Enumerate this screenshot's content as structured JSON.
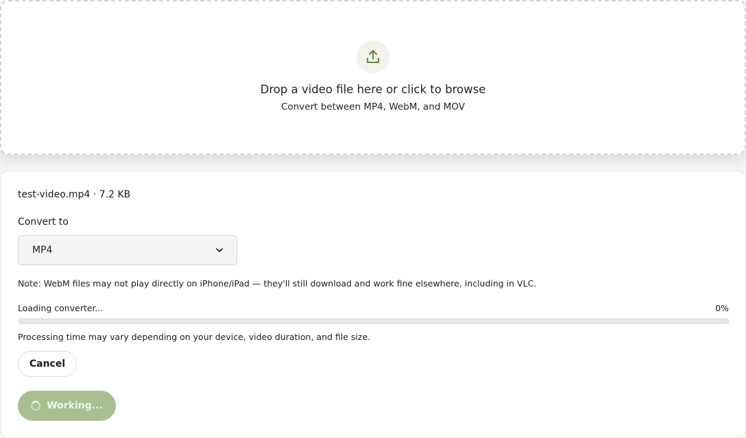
{
  "dropzone": {
    "icon": "upload-icon",
    "title": "Drop a video file here or click to browse",
    "subtitle": "Convert between MP4, WebM, and MOV"
  },
  "file": {
    "info": "test-video.mp4 · 7.2 KB"
  },
  "convert": {
    "label": "Convert to",
    "selected": "MP4"
  },
  "note": "Note: WebM files may not play directly on iPhone/iPad — they'll still download and work fine elsewhere, including in VLC.",
  "progress": {
    "status": "Loading converter...",
    "percent_label": "0%",
    "value": 0
  },
  "processing_note": "Processing time may vary depending on your device, video duration, and file size.",
  "buttons": {
    "cancel": "Cancel",
    "working": "Working..."
  },
  "colors": {
    "accent": "#5a8a2c",
    "button_disabled": "#a9bf91",
    "upload_icon_bg": "#f1f3ec"
  }
}
